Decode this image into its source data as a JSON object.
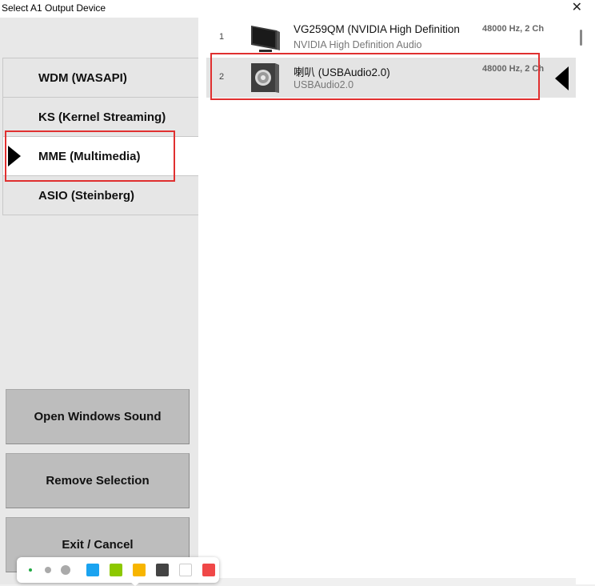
{
  "window": {
    "title": "Select A1 Output Device",
    "close_glyph": "✕"
  },
  "drivers": [
    {
      "label": "WDM (WASAPI)",
      "selected": false
    },
    {
      "label": "KS (Kernel Streaming)",
      "selected": false
    },
    {
      "label": "MME (Multimedia)",
      "selected": true
    },
    {
      "label": "ASIO (Steinberg)",
      "selected": false
    }
  ],
  "actions": {
    "open_sound": "Open Windows Sound",
    "remove": "Remove Selection",
    "exit": "Exit / Cancel"
  },
  "devices": [
    {
      "num": "1",
      "name": "VG259QM (NVIDIA High Definition",
      "sub": "NVIDIA High Definition Audio",
      "format": "48000 Hz, 2 Ch",
      "icon": "monitor-icon",
      "selected": false
    },
    {
      "num": "2",
      "name": "喇叭 (USBAudio2.0)",
      "sub": "USBAudio2.0",
      "format": "48000 Hz, 2 Ch",
      "icon": "speaker-icon",
      "selected": true
    }
  ],
  "palette": {
    "colors": [
      "#1aa3f0",
      "#8cc800",
      "#f7b500",
      "#444444",
      "#ffffff",
      "#f04848"
    ],
    "active_dot_color": "#22aa44"
  }
}
